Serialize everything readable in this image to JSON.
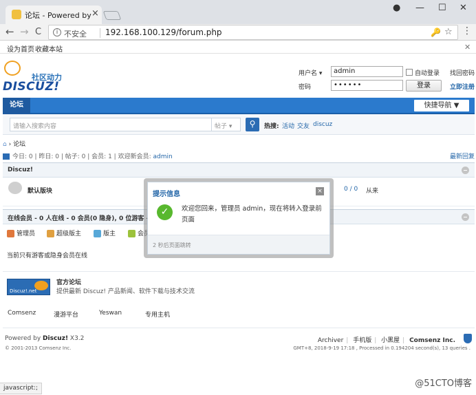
{
  "browser": {
    "tab_title": "论坛 - Powered by Discuz!",
    "tab_close": "×",
    "window_controls": {
      "account": "●",
      "minimize": "—",
      "maximize": "☐",
      "close": "✕"
    },
    "nav": {
      "back": "←",
      "forward": "→",
      "reload": "C"
    },
    "address": {
      "info_icon": "i",
      "security_label": "不安全",
      "url": "192.168.100.129/forum.php"
    },
    "toolbar_icons": {
      "key": "🔑",
      "star": "☆",
      "menu": "⋮"
    },
    "bookmarks": [
      "设为首页",
      "收藏本站"
    ],
    "bookmarks_close": "✕",
    "status_url": "javascript:;"
  },
  "header": {
    "logo_tagline": "社区动力",
    "logo_text": "DISCUZ!",
    "login": {
      "username_label": "用户名",
      "username_value": "admin",
      "password_label": "密码",
      "password_value": "••••••",
      "remember_label": "自动登录",
      "forgot_password": "找回密码",
      "submit_label": "登录",
      "register_link": "立即注册"
    }
  },
  "navbar": {
    "active_item": "论坛",
    "quick_nav": "快捷导航 ▼"
  },
  "search": {
    "placeholder": "请输入搜索内容",
    "type_label": "帖子",
    "hot_label": "热搜:",
    "hot_links": [
      "活动",
      "交友",
      "discuz"
    ]
  },
  "breadcrumb": {
    "sep": "›",
    "current": "论坛"
  },
  "stats": {
    "today": "今日: 0",
    "yesterday": "昨日: 0",
    "posts": "帖子: 0",
    "members": "会员: 1",
    "welcome_label": "欢迎新会员:",
    "newest_member": "admin",
    "latest_reply_link": "最新回复"
  },
  "category": {
    "name": "Discuz!",
    "board": {
      "name": "默认版块",
      "stats": "0 / 0",
      "last_post": "从来"
    }
  },
  "online": {
    "title": "在线会员 - 0 人在线 - 0 会员(0 隐身), 0 位游客 - 最",
    "legend": [
      {
        "label": "管理员",
        "color": "#e0783c"
      },
      {
        "label": "超级版主",
        "color": "#e0a040"
      },
      {
        "label": "版主",
        "color": "#58a8d8"
      },
      {
        "label": "会员",
        "color": "#9cc23c"
      }
    ],
    "note": "当前只有游客或隐身会员在线"
  },
  "official": {
    "logo_text": "Discuz!.net",
    "title": "官方论坛",
    "desc": "提供最新 Discuz! 产品新闻、软件下载与技术交流"
  },
  "friend_links": [
    "Comsenz",
    "漫游平台",
    "Yeswan",
    "专用主机"
  ],
  "footer": {
    "powered_prefix": "Powered by",
    "product": "Discuz!",
    "version": "X3.2",
    "copyright": "© 2001-2013 Comsenz Inc.",
    "links": [
      "Archiver",
      "手机版",
      "小黑屋",
      "Comsenz Inc."
    ],
    "gmt": "GMT+8, 2018-9-19 17:18 , Processed in 0.194204 second(s), 13 queries ."
  },
  "modal": {
    "title": "提示信息",
    "close": "×",
    "check": "✓",
    "message": "欢迎您回来，管理员 admin，现在将转入登录前页面",
    "redirect_note": "2 秒后页面跳转"
  },
  "watermark": "@51CTO博客"
}
